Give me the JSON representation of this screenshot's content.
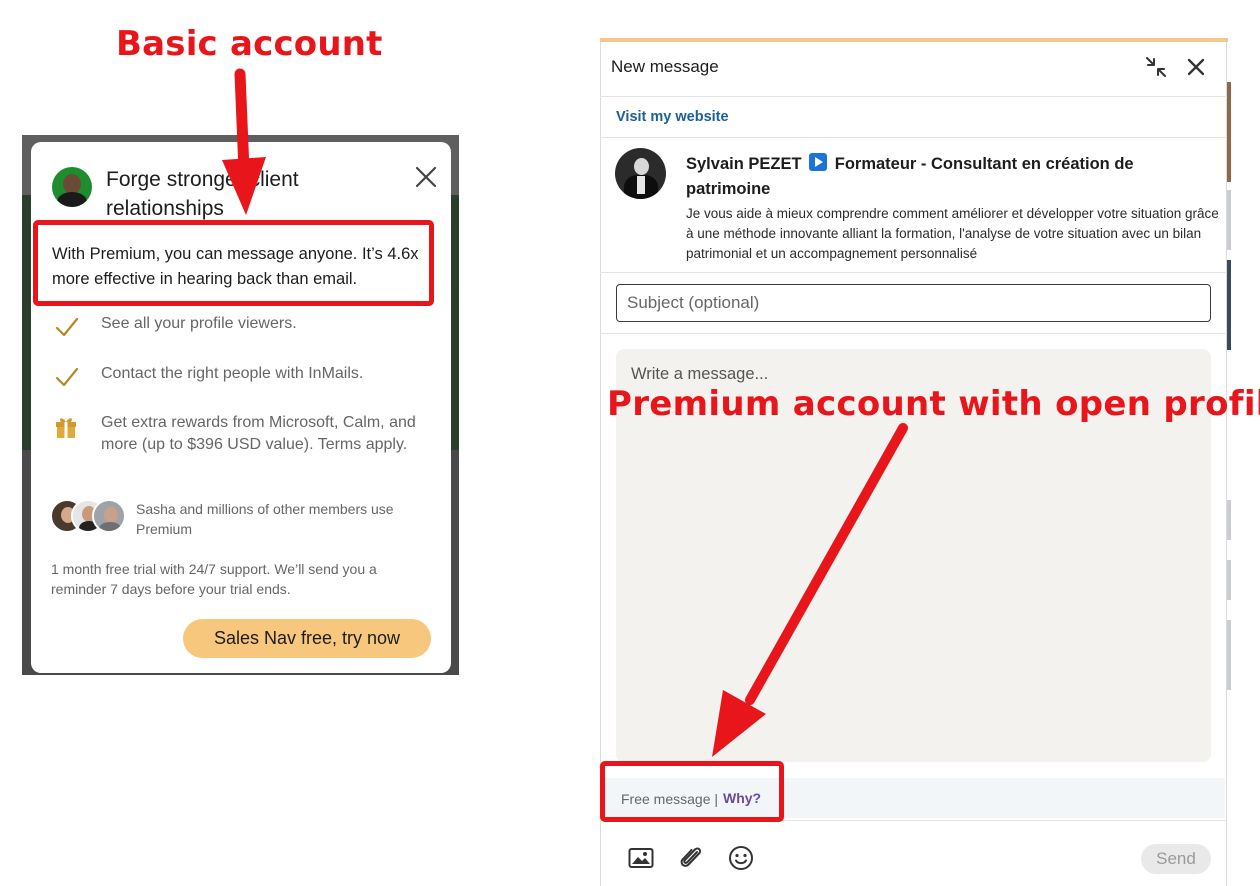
{
  "annotations": {
    "basic_label": "Basic account",
    "premium_label": "Premium account with open profile"
  },
  "premium_card": {
    "title": "Forge stronger client relationships",
    "description": "With Premium, you can message anyone. It’s 4.6x more effective in hearing back than email.",
    "features": [
      {
        "icon": "check-icon",
        "text": "See all your profile viewers."
      },
      {
        "icon": "check-icon",
        "text": "Contact the right people with InMails."
      },
      {
        "icon": "gift-icon",
        "text": "Get extra rewards from Microsoft, Calm, and more (up to $396 USD value). Terms apply."
      }
    ],
    "social_proof": "Sasha and millions of other members use Premium",
    "trial_text": "1 month free trial with 24/7 support. We’ll send you a reminder 7 days before your trial ends.",
    "cta_label": "Sales Nav free, try now"
  },
  "message_panel": {
    "title": "New message",
    "website_link": "Visit my website",
    "recipient": {
      "name_part1": "Sylvain PEZET",
      "name_part2": "Formateur - Consultant en création de patrimoine",
      "bio": "Je vous aide à mieux comprendre comment améliorer et développer votre situation grâce à une méthode innovante alliant la formation, l'analyse de votre situation avec un bilan patrimonial et un accompagnement personnalisé"
    },
    "subject_placeholder": "Subject (optional)",
    "message_placeholder": "Write a message...",
    "free_message_label": "Free message |",
    "why_label": "Why?",
    "send_label": "Send",
    "toolbar_icons": [
      "image-icon",
      "paperclip-icon",
      "emoji-icon"
    ]
  },
  "colors": {
    "annotation_red": "#e8151b",
    "cta_gold": "#f8c77e",
    "link_blue": "#1c5e9a",
    "check_gold": "#b5872b"
  }
}
